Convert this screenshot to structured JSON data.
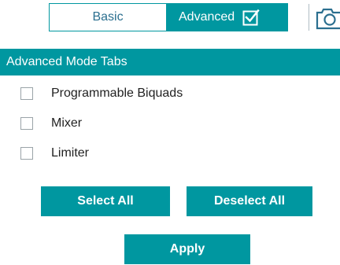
{
  "mode_toggle": {
    "basic_label": "Basic",
    "advanced_label": "Advanced",
    "selected": "Advanced",
    "icons": {
      "advanced_check": "checkbox-checked-icon",
      "camera": "camera-icon"
    }
  },
  "section": {
    "title": "Advanced Mode Tabs"
  },
  "options": [
    {
      "label": "Programmable Biquads",
      "checked": false
    },
    {
      "label": "Mixer",
      "checked": false
    },
    {
      "label": "Limiter",
      "checked": false
    }
  ],
  "buttons": {
    "select_all": "Select All",
    "deselect_all": "Deselect All",
    "apply": "Apply"
  },
  "colors": {
    "accent": "#0097a0",
    "text": "#222222",
    "basic_text": "#2b6f8f"
  }
}
